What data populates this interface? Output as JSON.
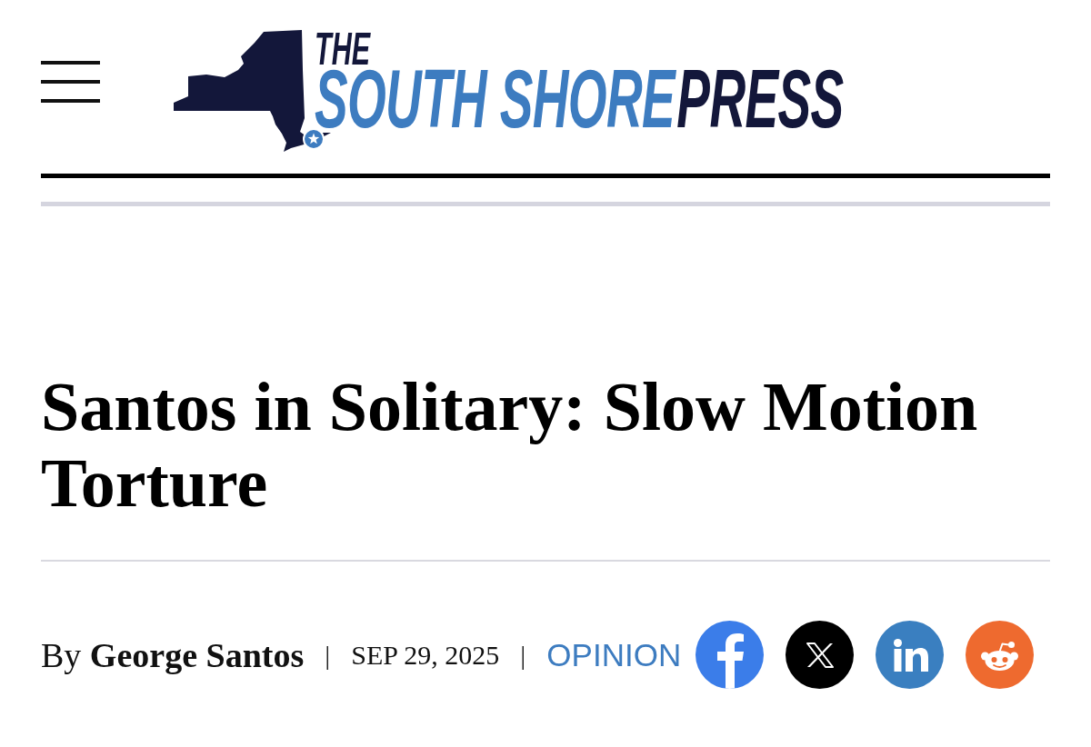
{
  "header": {
    "logo": {
      "line_1": "THE",
      "line_2_accent": "SOUTH SHORE",
      "line_2_rest": "PRESS"
    }
  },
  "article": {
    "headline": "Santos in Solitary: Slow Motion Torture",
    "meta": [
      {
        "kind": "author",
        "text": "By **George Santos**"
      },
      {
        "kind": "separator",
        "text": "|"
      },
      {
        "kind": "date",
        "text": "SEP 29, 2025"
      },
      {
        "kind": "separator",
        "text": "|"
      },
      {
        "kind": "category",
        "text": "OPINION"
      }
    ],
    "share_buttons": [
      {
        "kind": "facebook",
        "color": "#3b7de9"
      },
      {
        "kind": "x",
        "color": "#000000"
      },
      {
        "kind": "linkedin",
        "color": "#3a7fc0"
      },
      {
        "kind": "reddit",
        "color": "#ee6a2f"
      }
    ]
  }
}
